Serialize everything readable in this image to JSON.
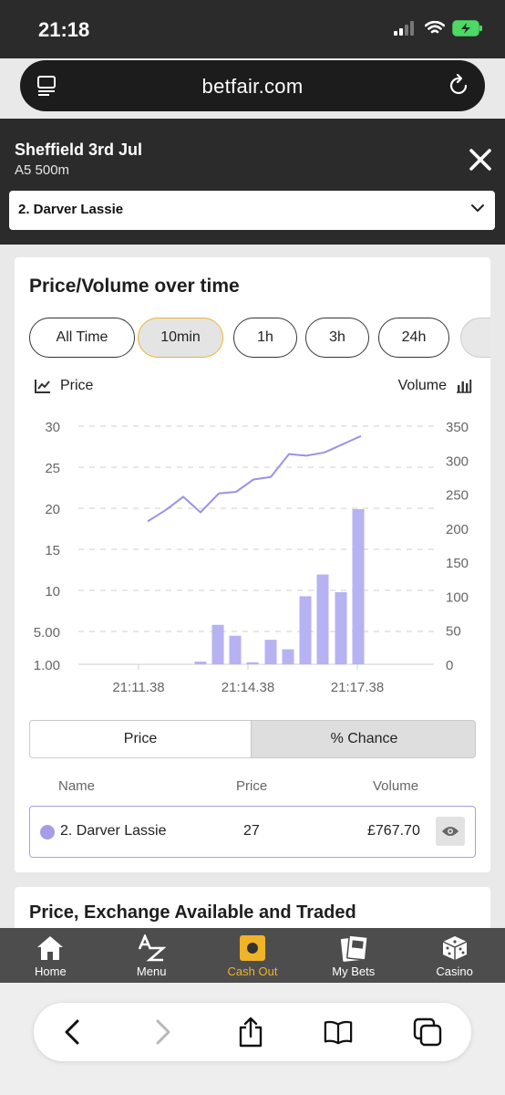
{
  "status_bar": {
    "time": "21:18"
  },
  "browser": {
    "url": "betfair.com"
  },
  "race": {
    "title": "Sheffield 3rd Jul",
    "subtitle": "A5 500m"
  },
  "runner_select": {
    "value": "2. Darver Lassie"
  },
  "card": {
    "title": "Price/Volume over time",
    "time_filters": [
      {
        "label": "All Time",
        "active": false
      },
      {
        "label": "10min",
        "active": true
      },
      {
        "label": "1h",
        "active": false
      },
      {
        "label": "3h",
        "active": false
      },
      {
        "label": "24h",
        "active": false
      }
    ],
    "legend_price": "Price",
    "legend_volume": "Volume"
  },
  "chart_data": {
    "type": "line+bar",
    "price_axis_ticks": [
      "30",
      "25",
      "20",
      "15",
      "10",
      "5.00",
      "1.00"
    ],
    "volume_axis_ticks": [
      "350",
      "300",
      "250",
      "200",
      "150",
      "100",
      "50",
      "0"
    ],
    "x_tick_labels": [
      "21:11.38",
      "21:14.38",
      "21:17.38"
    ],
    "grid": true,
    "price_series": {
      "name": "Price",
      "color": "#9b93e6",
      "values": [
        18.4,
        19.8,
        21.4,
        19.5,
        21.8,
        22.0,
        23.5,
        23.8,
        26.6,
        26.4,
        26.8,
        28.8
      ]
    },
    "volume_series": {
      "name": "Volume",
      "color": "#b7b2f2",
      "values": [
        4,
        58,
        42,
        3,
        36,
        22,
        100,
        132,
        106,
        228
      ]
    }
  },
  "toggle": {
    "price_label": "Price",
    "chance_label": "% Chance"
  },
  "table": {
    "headers": {
      "name": "Name",
      "price": "Price",
      "volume": "Volume"
    },
    "row": {
      "name": "2. Darver Lassie",
      "price": "27",
      "volume": "£767.70",
      "color": "#a59de8"
    }
  },
  "card2": {
    "title": "Price, Exchange Available and Traded"
  },
  "bottom_nav": [
    {
      "label": "Home",
      "icon": "home-icon",
      "active": false
    },
    {
      "label": "Menu",
      "icon": "az-menu-icon",
      "active": false
    },
    {
      "label": "Cash Out",
      "icon": "cash-out-icon",
      "active": true
    },
    {
      "label": "My Bets",
      "icon": "bets-slip-icon",
      "active": false
    },
    {
      "label": "Casino",
      "icon": "dice-icon",
      "active": false
    }
  ],
  "colors": {
    "accent": "#f0b428",
    "series": "#a59de8",
    "header_bg": "#2b2b2b"
  }
}
